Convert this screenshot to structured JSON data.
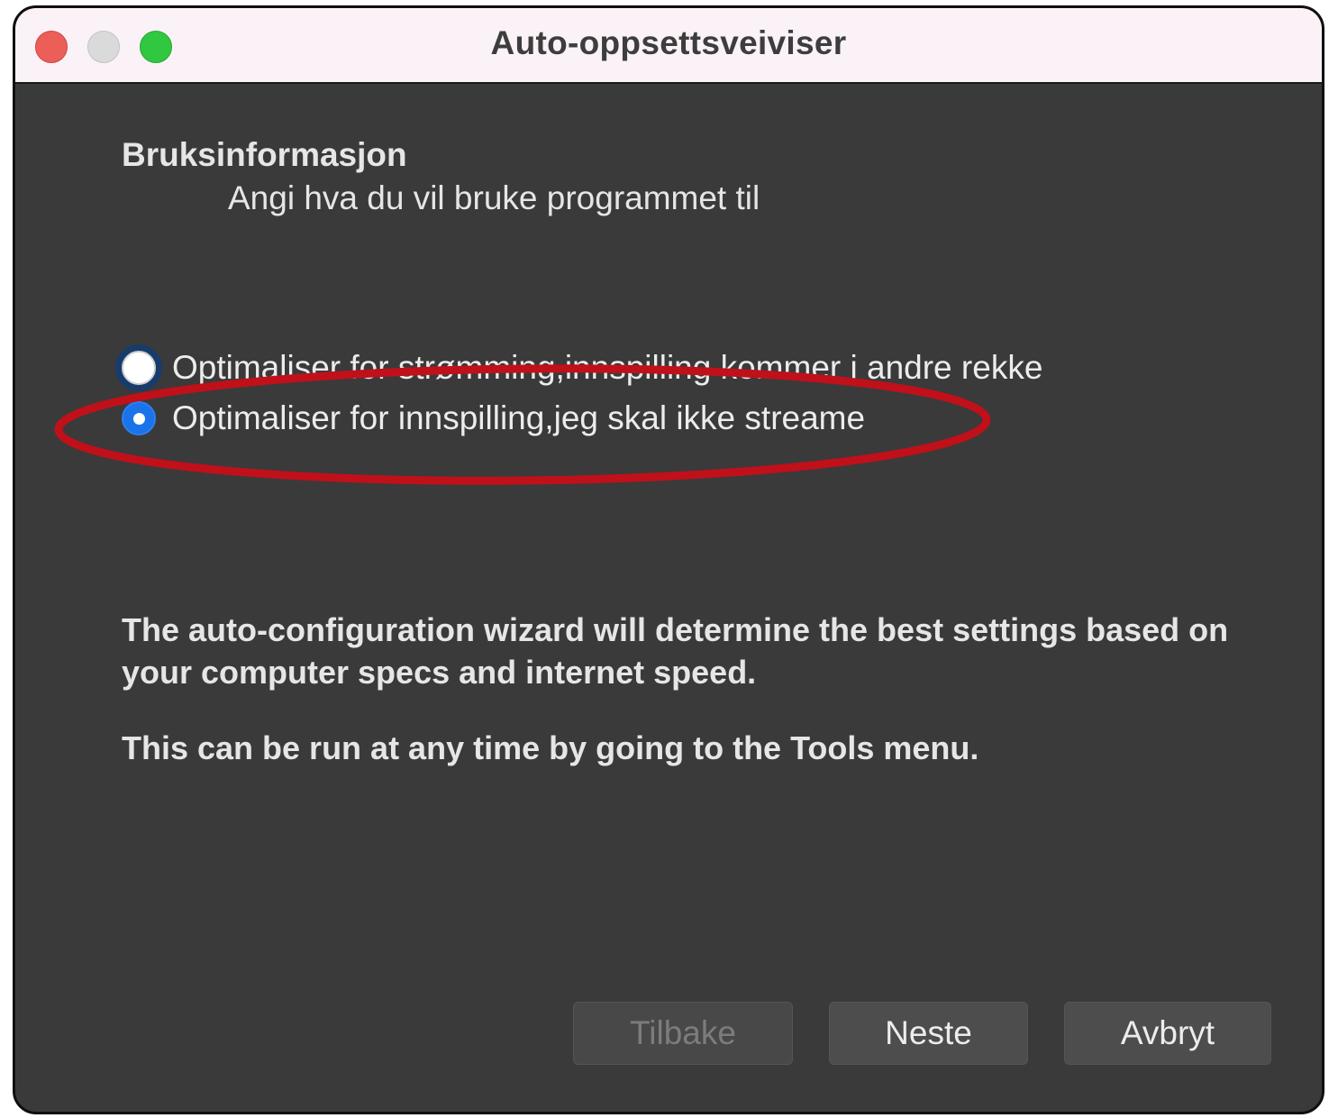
{
  "window": {
    "title": "Auto-oppsettsveiviser"
  },
  "page": {
    "heading": "Bruksinformasjon",
    "subheading": "Angi hva du vil bruke programmet til"
  },
  "options": [
    {
      "label": "Optimaliser for strømming,innspilling kommer i andre rekke",
      "selected": false
    },
    {
      "label": "Optimaliser for innspilling,jeg skal ikke streame",
      "selected": true
    }
  ],
  "info": {
    "paragraph1": "The auto-configuration wizard will determine the best settings based on your computer specs and internet speed.",
    "paragraph2": "This can be run at any time by going to the Tools menu."
  },
  "buttons": {
    "back": "Tilbake",
    "next": "Neste",
    "cancel": "Avbryt"
  },
  "colors": {
    "window_bg": "#3a3a3a",
    "titlebar_bg": "#fbf2f7",
    "accent": "#1a73e8",
    "annotation": "#c0101a"
  }
}
